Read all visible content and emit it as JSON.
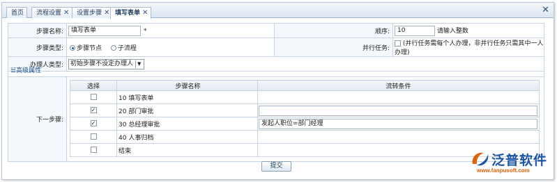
{
  "tabs": [
    {
      "label": "首页",
      "closable": false,
      "active": false
    },
    {
      "label": "流程设置",
      "closable": true,
      "active": false
    },
    {
      "label": "设置步骤",
      "closable": true,
      "active": false
    },
    {
      "label": "填写表单",
      "closable": true,
      "active": true
    }
  ],
  "tab_close_glyph": "✕",
  "window_close_glyph": "✕",
  "form": {
    "step_name_label": "步骤名称:",
    "step_name_value": "填写表单",
    "required_mark": "*",
    "order_label": "顺序:",
    "order_value": "10",
    "order_hint": "请输入整数",
    "step_type_label": "步骤类型:",
    "step_type_option1": "步骤节点",
    "step_type_option2": "子流程",
    "parallel_label": "并行任务:",
    "parallel_hint": "(并行任务需每个人办理，非并行任务只需其中一人办理)",
    "handler_type_label": "办理人类型:",
    "handler_type_value": "初始步骤不设定办理人"
  },
  "advanced": {
    "label": "☱高级属性"
  },
  "next_steps": {
    "label": "下一步骤:",
    "headers": {
      "select": "选择",
      "name": "步骤名称",
      "condition": "流转条件"
    },
    "rows": [
      {
        "name": "10 填写表单",
        "checked": false,
        "has_condition_input": false,
        "condition": ""
      },
      {
        "name": "20 部门审批",
        "checked": true,
        "has_condition_input": true,
        "condition": ""
      },
      {
        "name": "30 总经理审批",
        "checked": true,
        "has_condition_input": true,
        "condition": "发起人职位=部门经理"
      },
      {
        "name": "40 人事归档",
        "checked": false,
        "has_condition_input": false,
        "condition": ""
      },
      {
        "name": "结束",
        "checked": false,
        "has_condition_input": false,
        "condition": ""
      }
    ]
  },
  "submit_label": "提交",
  "brand": {
    "name": "泛普软件",
    "url": "www.fanpusoft.com",
    "primary_color": "#1c55a6",
    "accent_color": "#e0620a"
  }
}
